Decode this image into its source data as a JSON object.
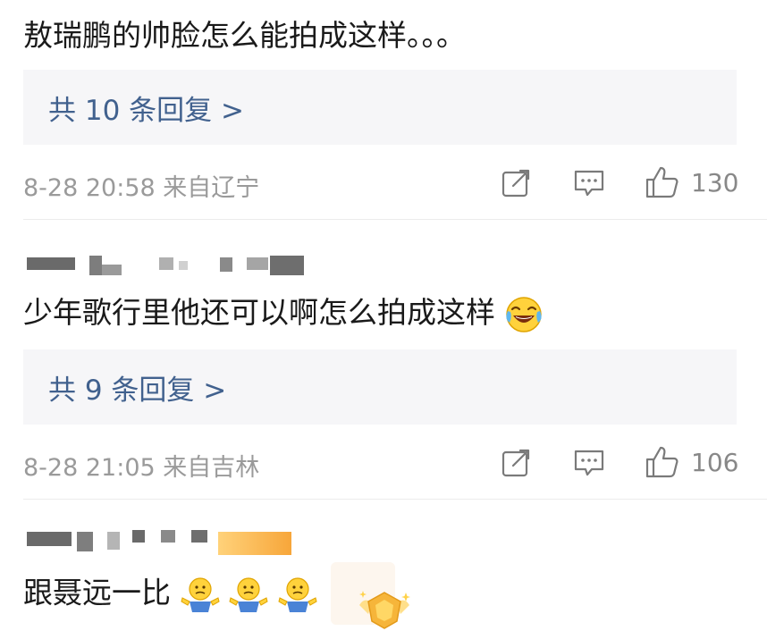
{
  "comments": [
    {
      "text": "敖瑞鹏的帅脸怎么能拍成这样。。。",
      "replies_label": "共 10 条回复 >",
      "meta": "8-28 20:58 来自辽宁",
      "likes": "130"
    },
    {
      "text": "少年歌行里他还可以啊怎么拍成这样",
      "replies_label": "共 9 条回复 >",
      "meta": "8-28 21:05 来自吉林",
      "likes": "106"
    },
    {
      "text": "跟聂远一比"
    }
  ],
  "icons": {
    "share": "share-icon",
    "comment": "comment-icon",
    "like": "thumbs-up-icon",
    "laugh": "laugh-cry-emoji",
    "shrug": "shrug-emoji",
    "badge": "fan-badge-icon"
  },
  "colors": {
    "link": "#41618e",
    "meta": "#9a9a9a",
    "reply_bg": "#f6f6f8",
    "divider": "#ececec"
  }
}
